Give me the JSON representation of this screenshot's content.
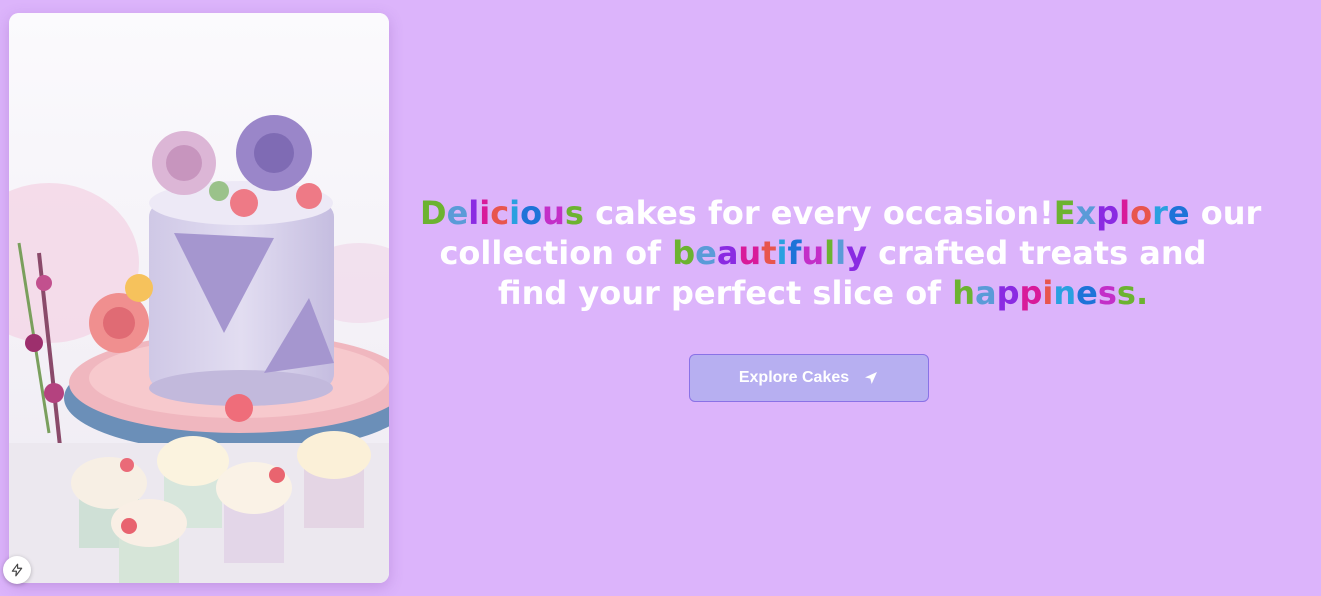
{
  "hero": {
    "image_alt_icon": "cake-photo",
    "lines": [
      [
        {
          "text": "Delicious",
          "colorful": true
        },
        {
          "text": " cakes for every occasion!",
          "colorful": false
        },
        {
          "text": "Explore",
          "colorful": true
        },
        {
          "text": " our",
          "colorful": false
        }
      ],
      [
        {
          "text": "collection of ",
          "colorful": false
        },
        {
          "text": "beautifully",
          "colorful": true
        },
        {
          "text": " crafted treats and",
          "colorful": false
        }
      ],
      [
        {
          "text": "find your perfect slice of ",
          "colorful": false
        },
        {
          "text": "happiness",
          "colorful": true
        },
        {
          "text": ".",
          "colorful": true
        }
      ]
    ],
    "rainbow": [
      "#6cb330",
      "#5a9bd8",
      "#8a2be2",
      "#d81b9a",
      "#e8554e",
      "#2aa0e0",
      "#1e73d8",
      "#c32fc8"
    ],
    "cta_label": "Explore Cakes",
    "cta_icon": "send-arrow-icon"
  },
  "badge_icon": "lightning-icon"
}
